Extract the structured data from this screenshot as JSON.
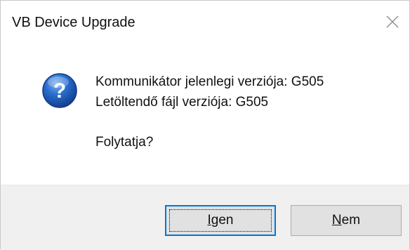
{
  "window": {
    "title": "VB Device Upgrade",
    "close_icon": "close-icon"
  },
  "message": {
    "icon": "question-icon",
    "line1": "Kommunikátor jelenlegi verziója: G505",
    "line2": "Letöltendő fájl verziója: G505",
    "line3": "Folytatja?"
  },
  "buttons": {
    "yes": {
      "mnemonic": "I",
      "rest": "gen"
    },
    "no": {
      "mnemonic": "N",
      "rest": "em"
    }
  },
  "colors": {
    "accent": "#0078d7",
    "icon_blue": "#1f5fb8",
    "footer_bg": "#f0f0f0",
    "button_bg": "#e1e1e1"
  }
}
